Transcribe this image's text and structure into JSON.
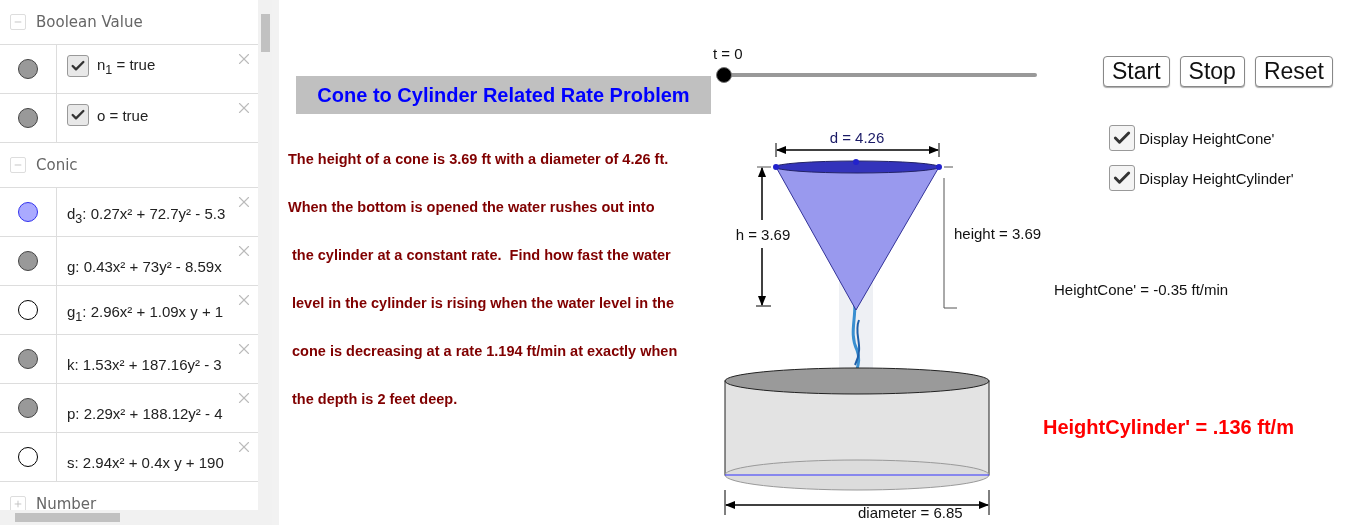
{
  "algebra": {
    "groups": [
      {
        "title": "Boolean Value",
        "expanded": true,
        "items": [
          {
            "kind": "boolean",
            "label": "n$_{1}$ = true",
            "checked": true,
            "visible": true,
            "color": "#999999"
          },
          {
            "kind": "boolean",
            "label": "o = true",
            "checked": true,
            "visible": true,
            "color": "#999999"
          }
        ]
      },
      {
        "title": "Conic",
        "expanded": true,
        "items": [
          {
            "kind": "formula",
            "label": "d$_{3}$: 0.27x² + 72.7y² - 5.3",
            "visible": true,
            "color": "#aaaaff"
          },
          {
            "kind": "formula",
            "label": "g: 0.43x² + 73y² - 8.59x",
            "visible": true,
            "color": "#999999"
          },
          {
            "kind": "formula",
            "label": "g$_{1}$: 2.96x² + 1.09x y + 1",
            "visible": false
          },
          {
            "kind": "formula",
            "label": "k: 1.53x² + 187.16y² - 3",
            "visible": true,
            "color": "#999999"
          },
          {
            "kind": "formula",
            "label": "p: 2.29x² + 188.12y² - 4",
            "visible": true,
            "color": "#999999"
          },
          {
            "kind": "formula",
            "label": "s: 2.94x² + 0.4x y + 190",
            "visible": false
          }
        ]
      },
      {
        "title": "Number",
        "expanded": false
      }
    ]
  },
  "canvas": {
    "slider": {
      "label": "t = 0",
      "level": 0
    },
    "title": "Cone to Cylinder Related Rate Problem",
    "problem": [
      "The height of a cone is 3.69 ft with a diameter of 4.26 ft.",
      "When the bottom is opened the water rushes out into",
      " the cylinder at a constant rate.  Find how fast the water",
      " level in the cylinder is rising when the water level in the",
      " cone is decreasing at a rate 1.194 ft/min at exactly when",
      " the depth is 2 feet deep."
    ],
    "buttons": [
      "Start",
      "Stop",
      "Reset"
    ],
    "checkboxes": [
      {
        "label": "Display HeightCone'",
        "checked": true
      },
      {
        "label": "Display HeightCylinder'",
        "checked": true
      }
    ],
    "figure": {
      "top_diameter": "d = 4.26",
      "cone_h": "h = 3.69",
      "cone_height": "height = 3.69",
      "bottom_diameter": "diameter = 6.85"
    },
    "readouts": [
      {
        "kind": "plain",
        "text": "HeightCone' = -0.35 ft/min"
      },
      {
        "kind": "emphasis",
        "text": "HeightCylinder' = .136 ft/m"
      }
    ]
  }
}
